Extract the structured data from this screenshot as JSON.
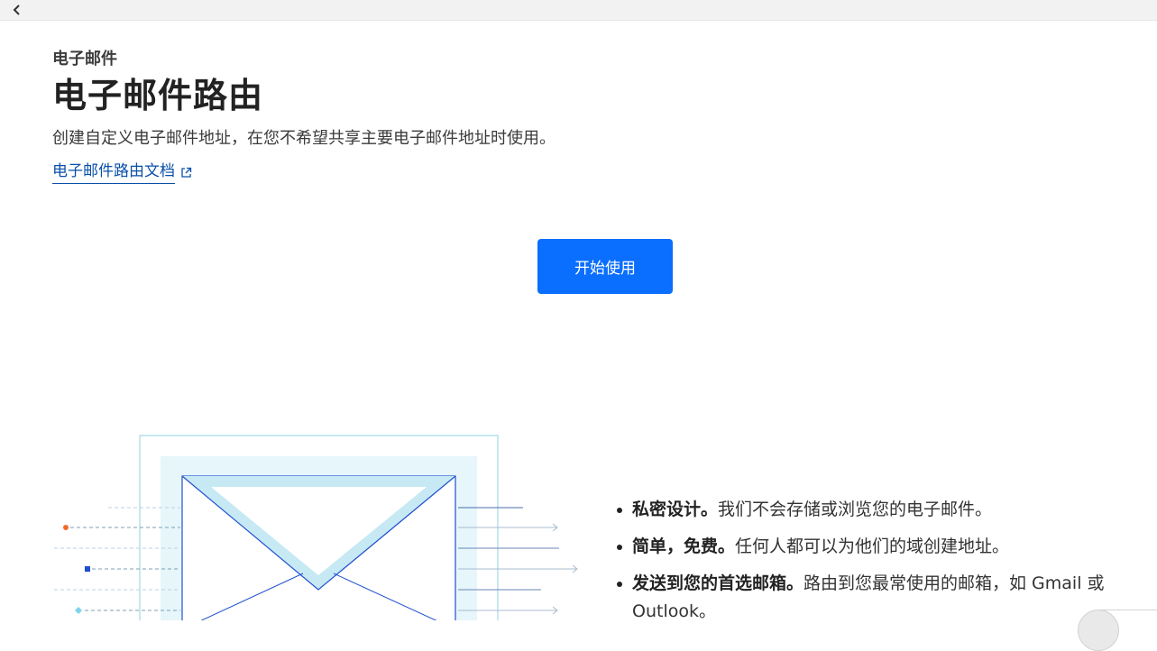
{
  "nav": {
    "back_label": ""
  },
  "header": {
    "eyebrow": "电子邮件",
    "title": "电子邮件路由",
    "subtitle": "创建自定义电子邮件地址，在您不希望共享主要电子邮件地址时使用。",
    "doc_link": "电子邮件路由文档"
  },
  "cta": {
    "start_label": "开始使用"
  },
  "features": [
    {
      "bold": "私密设计。",
      "text": "我们不会存储或浏览您的电子邮件。"
    },
    {
      "bold": "简单，免费。",
      "text": "任何人都可以为他们的域创建地址。"
    },
    {
      "bold": "发送到您的首选邮箱。",
      "text": "路由到您最常使用的邮箱，如 Gmail 或 Outlook。"
    }
  ],
  "icons": {
    "back": "chevron-left-icon",
    "external": "external-link-icon",
    "illustration": "envelope-illustration"
  },
  "colors": {
    "primary_button": "#0a6eff",
    "link": "#0a4fa8",
    "envelope_blue": "#1f4fd0",
    "envelope_fill": "#c6e9f4",
    "accent_orange": "#f26b2c",
    "accent_cyan": "#7fd3ea"
  }
}
